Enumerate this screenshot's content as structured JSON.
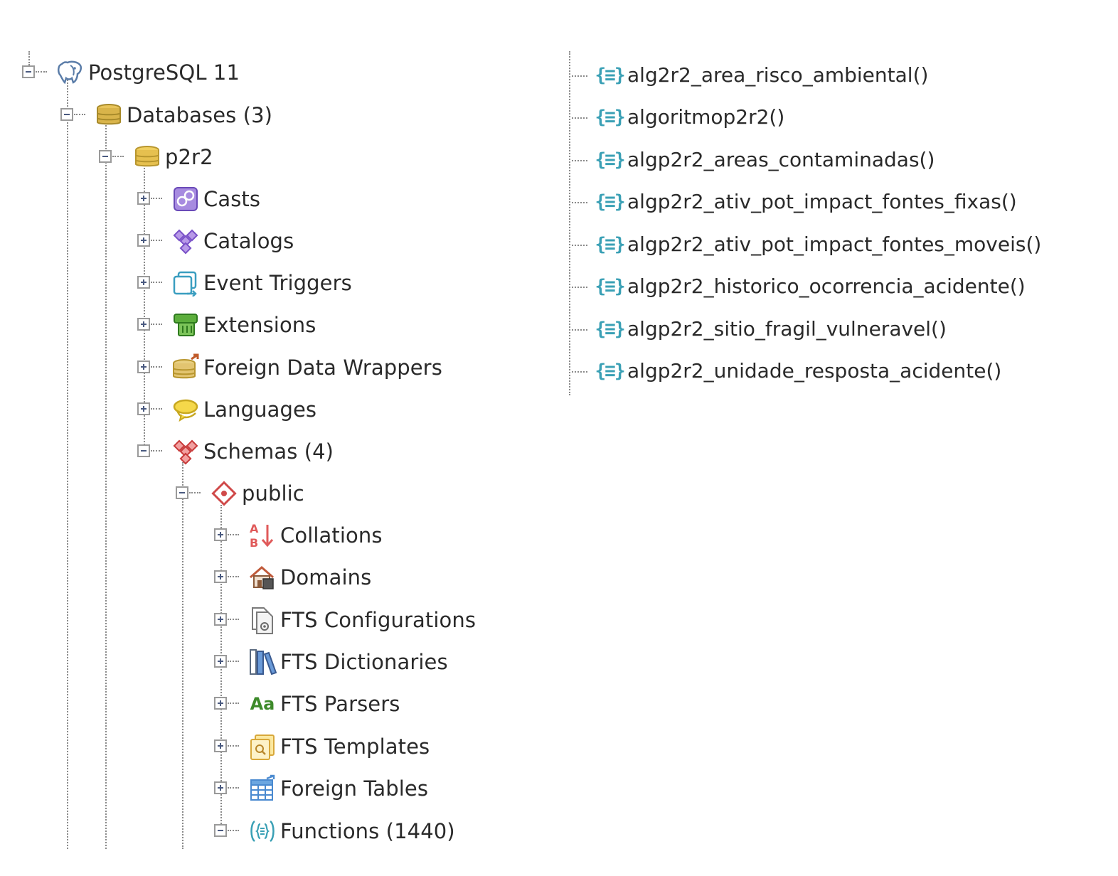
{
  "tree": {
    "server": {
      "label": "PostgreSQL 11",
      "expanded": true,
      "icon": "elephant-icon"
    },
    "databases": {
      "label": "Databases (3)",
      "expanded": true,
      "icon": "databases-icon"
    },
    "database": {
      "label": "p2r2",
      "expanded": true,
      "icon": "database-icon"
    },
    "db_children": [
      {
        "label": "Casts",
        "expanded": false,
        "icon": "casts-icon"
      },
      {
        "label": "Catalogs",
        "expanded": false,
        "icon": "catalogs-icon"
      },
      {
        "label": "Event Triggers",
        "expanded": false,
        "icon": "event-triggers-icon"
      },
      {
        "label": "Extensions",
        "expanded": false,
        "icon": "extensions-icon"
      },
      {
        "label": "Foreign Data Wrappers",
        "expanded": false,
        "icon": "foreign-data-wrappers-icon"
      },
      {
        "label": "Languages",
        "expanded": false,
        "icon": "languages-icon"
      },
      {
        "label": "Schemas (4)",
        "expanded": true,
        "icon": "schemas-icon"
      }
    ],
    "schema": {
      "label": "public",
      "expanded": true,
      "icon": "schema-icon"
    },
    "schema_children": [
      {
        "label": "Collations",
        "expanded": false,
        "icon": "collations-icon"
      },
      {
        "label": "Domains",
        "expanded": false,
        "icon": "domains-icon"
      },
      {
        "label": "FTS Configurations",
        "expanded": false,
        "icon": "fts-configurations-icon"
      },
      {
        "label": "FTS Dictionaries",
        "expanded": false,
        "icon": "fts-dictionaries-icon"
      },
      {
        "label": "FTS Parsers",
        "expanded": false,
        "icon": "fts-parsers-icon",
        "icon_text": "Aa"
      },
      {
        "label": "FTS Templates",
        "expanded": false,
        "icon": "fts-templates-icon"
      },
      {
        "label": "Foreign Tables",
        "expanded": false,
        "icon": "foreign-tables-icon"
      },
      {
        "label": "Functions (1440)",
        "expanded": true,
        "icon": "functions-icon"
      }
    ],
    "functions": [
      "alg2r2_area_risco_ambiental()",
      "algoritmop2r2()",
      "algp2r2_areas_contaminadas()",
      "algp2r2_ativ_pot_impact_fontes_fixas()",
      "algp2r2_ativ_pot_impact_fontes_moveis()",
      "algp2r2_historico_ocorrencia_acidente()",
      "algp2r2_sitio_fragil_vulneravel()",
      "algp2r2_unidade_resposta_acidente()"
    ],
    "function_icon_text": "{≡}"
  },
  "colors": {
    "guide_line": "#8a8a8a",
    "expander_border": "#9a9a9a",
    "function_icon": "#3aa0b5",
    "database_gold": "#d9b44a",
    "schema_red": "#d04a4a",
    "catalog_purple": "#8a5ac8",
    "extension_green": "#3d8a2a"
  }
}
